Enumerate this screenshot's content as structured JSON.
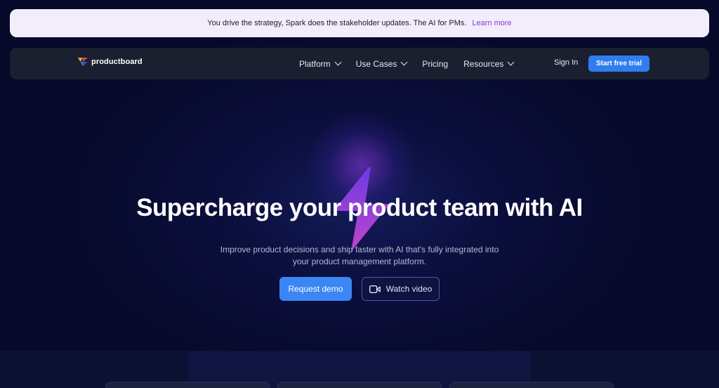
{
  "announcement": {
    "text": "You drive the strategy, Spark does the stakeholder updates. The AI for PMs.",
    "link": "Learn more",
    "link_color": "#7a3fe0"
  },
  "nav": {
    "logo_text": "productboard",
    "menu": [
      {
        "label": "Platform",
        "has_dropdown": true
      },
      {
        "label": "Use Cases",
        "has_dropdown": true
      },
      {
        "label": "Pricing",
        "has_dropdown": false
      },
      {
        "label": "Resources",
        "has_dropdown": true
      }
    ],
    "sign_in": "Sign In",
    "cta": "Start free trial",
    "cta_color": "#2f7df0"
  },
  "hero": {
    "headline": "Supercharge your product team with AI",
    "subtext_line1": "Improve product decisions and ship faster with AI that's fully integrated into",
    "subtext_line2": "your product management platform.",
    "primary_button": "Request demo",
    "secondary_button": "Watch video",
    "secondary_icon": "video-camera-icon",
    "accent_icon": "lightning-bolt-icon"
  },
  "colors": {
    "background": "#07092a",
    "nav_background": "#1b2030",
    "banner_background": "#f3ecfb",
    "primary_button": "#3b86f5"
  }
}
